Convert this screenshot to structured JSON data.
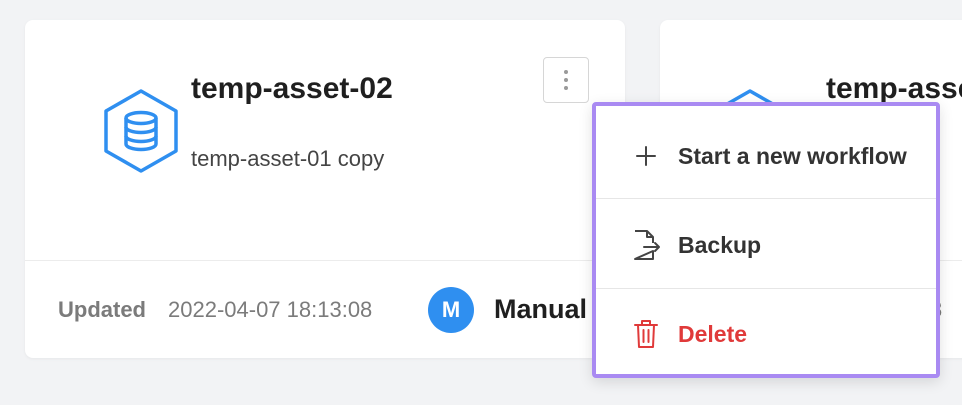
{
  "cards": [
    {
      "title": "temp-asset-02",
      "description": "temp-asset-01 copy",
      "updated_label": "Updated",
      "updated_value": "2022-04-07 18:13:08",
      "avatar_letter": "M",
      "mode": "Manual"
    },
    {
      "title": "temp-asse",
      "updated_value": "8"
    }
  ],
  "menu": {
    "items": [
      {
        "label": "Start a new workflow",
        "icon": "plus-icon"
      },
      {
        "label": "Backup",
        "icon": "backup-file-icon"
      },
      {
        "label": "Delete",
        "icon": "trash-icon"
      }
    ]
  },
  "colors": {
    "accent": "#2f8ff0",
    "menu_border": "#a98af2",
    "danger": "#e03a3a"
  }
}
